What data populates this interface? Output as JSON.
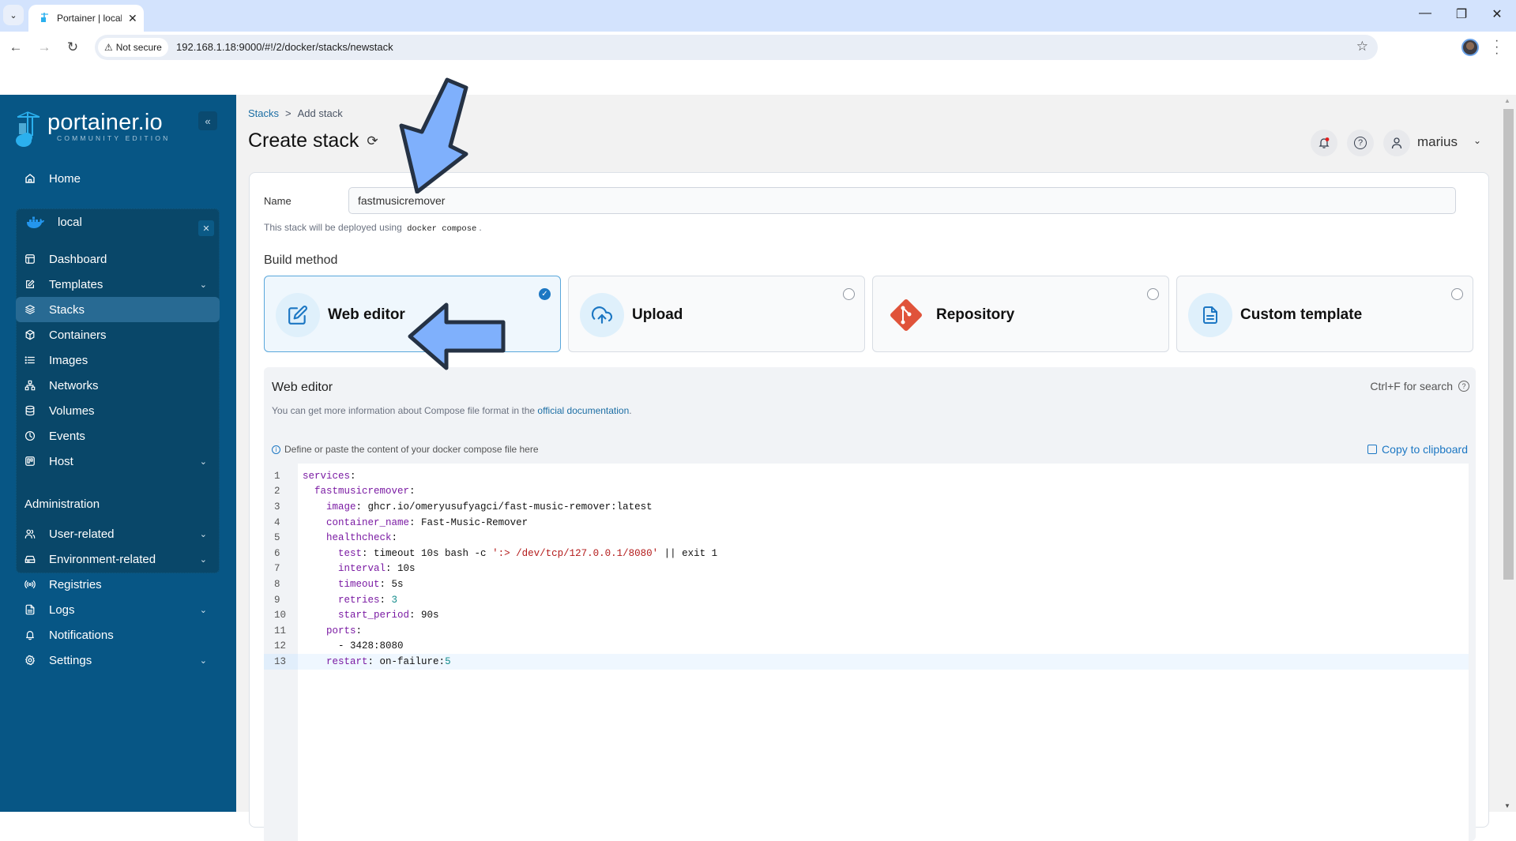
{
  "browser": {
    "tab_title": "Portainer | local",
    "security_label": "Not secure",
    "url": "192.168.1.18:9000/#!/2/docker/stacks/newstack"
  },
  "sidebar": {
    "brand": "portainer.io",
    "edition": "COMMUNITY EDITION",
    "collapse_icon": "«",
    "home": "Home",
    "environment": {
      "name": "local",
      "items": [
        {
          "label": "Dashboard",
          "icon": "dashboard-icon",
          "has_chevron": false
        },
        {
          "label": "Templates",
          "icon": "edit-icon",
          "has_chevron": true
        },
        {
          "label": "Stacks",
          "icon": "layers-icon",
          "has_chevron": false,
          "active": true
        },
        {
          "label": "Containers",
          "icon": "box-icon",
          "has_chevron": false
        },
        {
          "label": "Images",
          "icon": "list-icon",
          "has_chevron": false
        },
        {
          "label": "Networks",
          "icon": "network-icon",
          "has_chevron": false
        },
        {
          "label": "Volumes",
          "icon": "database-icon",
          "has_chevron": false
        },
        {
          "label": "Events",
          "icon": "clock-icon",
          "has_chevron": false
        },
        {
          "label": "Host",
          "icon": "trello-icon",
          "has_chevron": true
        }
      ]
    },
    "admin_label": "Administration",
    "admin_items": [
      {
        "label": "User-related",
        "icon": "users-icon",
        "has_chevron": true
      },
      {
        "label": "Environment-related",
        "icon": "hard-drive-icon",
        "has_chevron": true
      },
      {
        "label": "Registries",
        "icon": "radio-icon",
        "has_chevron": false
      },
      {
        "label": "Logs",
        "icon": "file-text-icon",
        "has_chevron": true
      },
      {
        "label": "Notifications",
        "icon": "bell-icon",
        "has_chevron": false
      },
      {
        "label": "Settings",
        "icon": "settings-icon",
        "has_chevron": true
      }
    ]
  },
  "header": {
    "breadcrumb": {
      "link": "Stacks",
      "separator": ">",
      "current": "Add stack"
    },
    "title": "Create stack",
    "user": "marius",
    "notification_dot_color": "#e11d1d"
  },
  "form": {
    "name_label": "Name",
    "name_value": "fastmusicremover",
    "deploy_note_prefix": "This stack will be deployed using",
    "deploy_note_code": "docker compose",
    "deploy_note_suffix": ".",
    "build_method_title": "Build method",
    "build_methods": [
      {
        "label": "Web editor",
        "icon": "edit-icon",
        "selected": true
      },
      {
        "label": "Upload",
        "icon": "upload-cloud-icon",
        "selected": false
      },
      {
        "label": "Repository",
        "icon": "git-icon",
        "selected": false
      },
      {
        "label": "Custom template",
        "icon": "file-text-icon",
        "selected": false
      }
    ]
  },
  "editor": {
    "title": "Web editor",
    "search_hint": "Ctrl+F for search",
    "info_prefix": "You can get more information about Compose file format in the",
    "info_link": "official documentation",
    "info_suffix": ".",
    "hint": "Define or paste the content of your docker compose file here",
    "copy_label": "Copy to clipboard",
    "active_line": 13,
    "lines": [
      "services:",
      "  fastmusicremover:",
      "    image: ghcr.io/omeryusufyagci/fast-music-remover:latest",
      "    container_name: Fast-Music-Remover",
      "    healthcheck:",
      "      test: timeout 10s bash -c ':> /dev/tcp/127.0.0.1/8080' || exit 1",
      "      interval: 10s",
      "      timeout: 5s",
      "      retries: 3",
      "      start_period: 90s",
      "    ports:",
      "      - 3428:8080",
      "    restart: on-failure:5"
    ]
  },
  "colors": {
    "sidebar_bg": "#075685",
    "accent": "#1c77c3",
    "annotation_arrow": "#7fb0fc"
  }
}
